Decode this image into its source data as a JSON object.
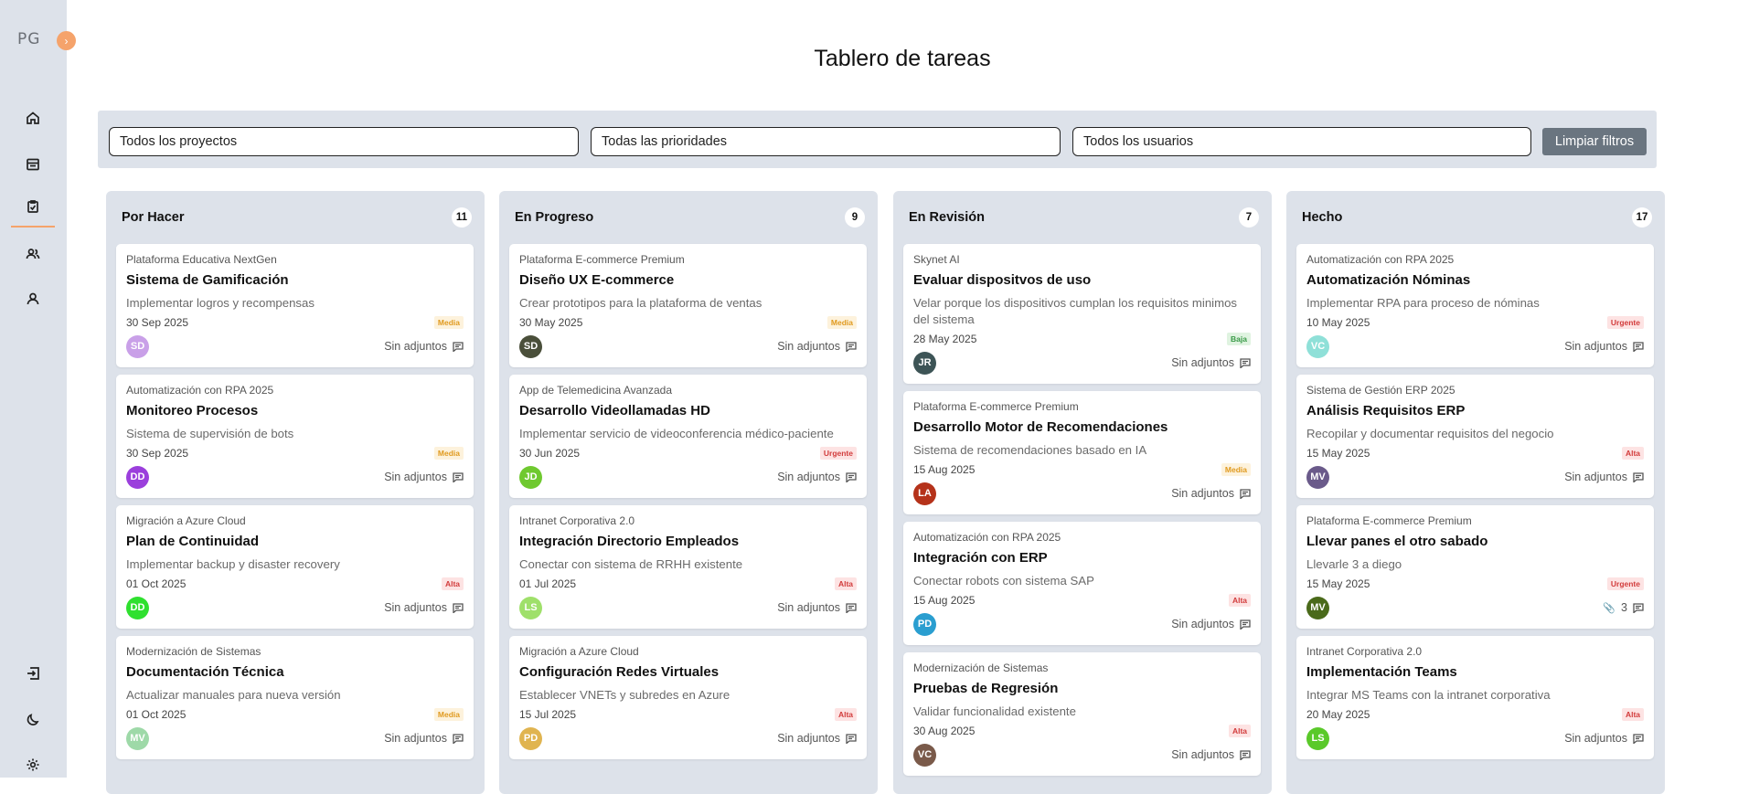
{
  "app": {
    "logo": "PG",
    "toggle": "›"
  },
  "page": {
    "title": "Tablero de tareas"
  },
  "sidebar": {
    "items": [
      {
        "name": "home",
        "icon": "home-icon"
      },
      {
        "name": "projects",
        "icon": "calendar-icon"
      },
      {
        "name": "tasks",
        "icon": "clipboard-check-icon",
        "active": true
      },
      {
        "name": "teams",
        "icon": "users-icon"
      },
      {
        "name": "profile",
        "icon": "user-icon"
      }
    ],
    "bottom": [
      {
        "name": "logout",
        "icon": "logout-icon"
      },
      {
        "name": "theme",
        "icon": "moon-icon"
      },
      {
        "name": "settings",
        "icon": "gear-icon"
      }
    ]
  },
  "filters": {
    "project": "Todos los proyectos",
    "priority": "Todas las prioridades",
    "user": "Todos los usuarios",
    "clear_label": "Limpiar filtros"
  },
  "colors": {
    "accent": "#f5a36b",
    "panel": "#dde2ea",
    "Media": "#e09a1f",
    "Urgente": "#d23c3c",
    "Alta": "#d23c3c",
    "Baja": "#3a9a48"
  },
  "columns": [
    {
      "title": "Por Hacer",
      "count": "11",
      "cards": [
        {
          "project": "Plataforma Educativa NextGen",
          "title": "Sistema de Gamificación",
          "desc": "Implementar logros y recompensas",
          "date": "30 Sep 2025",
          "priority": "Media",
          "initials": "SD",
          "avatar_color": "#c9a0e8",
          "attach": "Sin adjuntos"
        },
        {
          "project": "Automatización con RPA 2025",
          "title": "Monitoreo Procesos",
          "desc": "Sistema de supervisión de bots",
          "date": "30 Sep 2025",
          "priority": "Media",
          "initials": "DD",
          "avatar_color": "#9b3fdc",
          "attach": "Sin adjuntos"
        },
        {
          "project": "Migración a Azure Cloud",
          "title": "Plan de Continuidad",
          "desc": "Implementar backup y disaster recovery",
          "date": "01 Oct 2025",
          "priority": "Alta",
          "initials": "DD",
          "avatar_color": "#2fe02f",
          "attach": "Sin adjuntos"
        },
        {
          "project": "Modernización de Sistemas",
          "title": "Documentación Técnica",
          "desc": "Actualizar manuales para nueva versión",
          "date": "01 Oct 2025",
          "priority": "Media",
          "initials": "MV",
          "avatar_color": "#9ed9a8",
          "attach": "Sin adjuntos"
        }
      ]
    },
    {
      "title": "En Progreso",
      "count": "9",
      "cards": [
        {
          "project": "Plataforma E-commerce Premium",
          "title": "Diseño UX E-commerce",
          "desc": "Crear prototipos para la plataforma de ventas",
          "date": "30 May 2025",
          "priority": "Media",
          "initials": "SD",
          "avatar_color": "#4a4f3a",
          "attach": "Sin adjuntos"
        },
        {
          "project": "App de Telemedicina Avanzada",
          "title": "Desarrollo Videollamadas HD",
          "desc": "Implementar servicio de videoconferencia médico-paciente",
          "date": "30 Jun 2025",
          "priority": "Urgente",
          "initials": "JD",
          "avatar_color": "#6fc92f",
          "attach": "Sin adjuntos"
        },
        {
          "project": "Intranet Corporativa 2.0",
          "title": "Integración Directorio Empleados",
          "desc": "Conectar con sistema de RRHH existente",
          "date": "01 Jul 2025",
          "priority": "Alta",
          "initials": "LS",
          "avatar_color": "#9fe06a",
          "attach": "Sin adjuntos"
        },
        {
          "project": "Migración a Azure Cloud",
          "title": "Configuración Redes Virtuales",
          "desc": "Establecer VNETs y subredes en Azure",
          "date": "15 Jul 2025",
          "priority": "Alta",
          "initials": "PD",
          "avatar_color": "#e0b450",
          "attach": "Sin adjuntos"
        }
      ]
    },
    {
      "title": "En Revisión",
      "count": "7",
      "cards": [
        {
          "project": "Skynet AI",
          "title": "Evaluar dispositvos de uso",
          "desc": "Velar porque los dispositivos cumplan los requisitos minimos del sistema",
          "date": "28 May 2025",
          "priority": "Baja",
          "initials": "JR",
          "avatar_color": "#3d5456",
          "attach": "Sin adjuntos"
        },
        {
          "project": "Plataforma E-commerce Premium",
          "title": "Desarrollo Motor de Recomendaciones",
          "desc": "Sistema de recomendaciones basado en IA",
          "date": "15 Aug 2025",
          "priority": "Media",
          "initials": "LA",
          "avatar_color": "#b5321a",
          "attach": "Sin adjuntos"
        },
        {
          "project": "Automatización con RPA 2025",
          "title": "Integración con ERP",
          "desc": "Conectar robots con sistema SAP",
          "date": "15 Aug 2025",
          "priority": "Alta",
          "initials": "PD",
          "avatar_color": "#2a9ed0",
          "attach": "Sin adjuntos"
        },
        {
          "project": "Modernización de Sistemas",
          "title": "Pruebas de Regresión",
          "desc": "Validar funcionalidad existente",
          "date": "30 Aug 2025",
          "priority": "Alta",
          "initials": "VC",
          "avatar_color": "#7a5a4a",
          "attach": "Sin adjuntos"
        }
      ]
    },
    {
      "title": "Hecho",
      "count": "17",
      "cards": [
        {
          "project": "Automatización con RPA 2025",
          "title": "Automatización Nóminas",
          "desc": "Implementar RPA para proceso de nóminas",
          "date": "10 May 2025",
          "priority": "Urgente",
          "initials": "VC",
          "avatar_color": "#8fe0d8",
          "attach": "Sin adjuntos"
        },
        {
          "project": "Sistema de Gestión ERP 2025",
          "title": "Análisis Requisitos ERP",
          "desc": "Recopilar y documentar requisitos del negocio",
          "date": "15 May 2025",
          "priority": "Alta",
          "initials": "MV",
          "avatar_color": "#6a5a8a",
          "attach": "Sin adjuntos"
        },
        {
          "project": "Plataforma E-commerce Premium",
          "title": "Llevar panes el otro sabado",
          "desc": "Llevarle 3 a diego",
          "date": "15 May 2025",
          "priority": "Urgente",
          "initials": "MV",
          "avatar_color": "#4a6a1a",
          "attach": "3",
          "has_attachments": true
        },
        {
          "project": "Intranet Corporativa 2.0",
          "title": "Implementación Teams",
          "desc": "Integrar MS Teams con la intranet corporativa",
          "date": "20 May 2025",
          "priority": "Alta",
          "initials": "LS",
          "avatar_color": "#5ac92a",
          "attach": "Sin adjuntos"
        }
      ]
    }
  ]
}
